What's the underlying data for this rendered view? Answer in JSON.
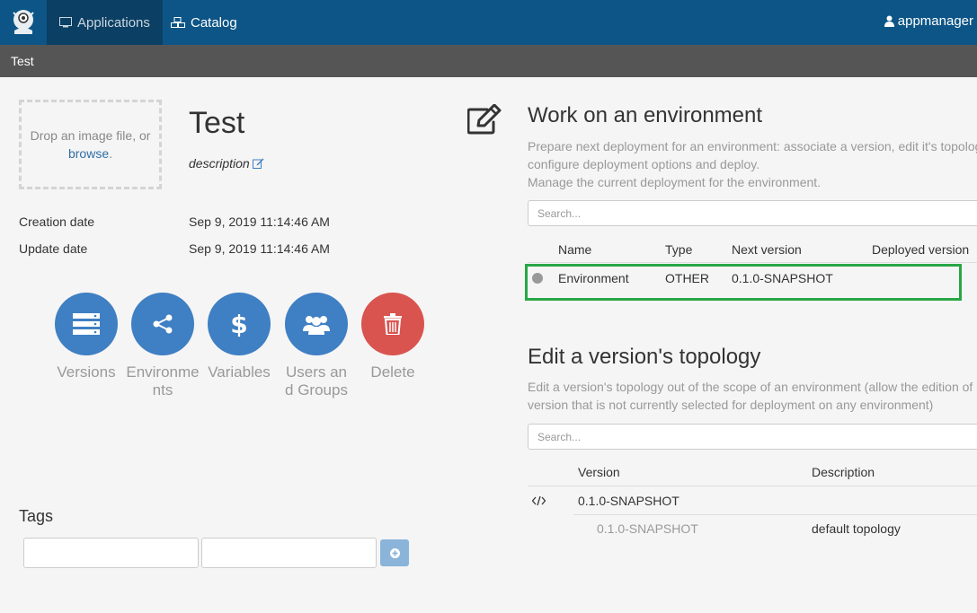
{
  "nav": {
    "tabs": [
      {
        "label": "Applications",
        "icon": "monitor-icon"
      },
      {
        "label": "Catalog",
        "icon": "cubes-icon"
      }
    ],
    "user": "appmanager"
  },
  "breadcrumb": "Test",
  "app": {
    "dropzone_text": "Drop an image file, or",
    "dropzone_link": "browse",
    "dropzone_period": ".",
    "title": "Test",
    "description": "description",
    "creation_label": "Creation date",
    "creation_value": "Sep 9, 2019 11:14:46 AM",
    "update_label": "Update date",
    "update_value": "Sep 9, 2019 11:14:46 AM"
  },
  "actions": [
    {
      "label": "Versions",
      "icon": "server-icon",
      "color": "#3f7fc3"
    },
    {
      "label": "Environments",
      "icon": "share-icon",
      "color": "#3f7fc3"
    },
    {
      "label": "Variables",
      "icon": "dollar-icon",
      "color": "#3f7fc3"
    },
    {
      "label": "Users and Groups",
      "icon": "users-icon",
      "color": "#3f7fc3"
    },
    {
      "label": "Delete",
      "icon": "trash-icon",
      "color": "#d9534f"
    }
  ],
  "tags": {
    "title": "Tags"
  },
  "environments": {
    "title": "Work on an environment",
    "desc1": "Prepare next deployment for an environment: associate a version, edit it's topology,",
    "desc2": "configure deployment options and deploy.",
    "desc3": "Manage the current deployment for the environment.",
    "search_placeholder": "Search...",
    "columns": [
      "Name",
      "Type",
      "Next version",
      "Deployed version"
    ],
    "rows": [
      {
        "name": "Environment",
        "type": "OTHER",
        "next_version": "0.1.0-SNAPSHOT",
        "deployed_version": ""
      }
    ]
  },
  "topology": {
    "title": "Edit a version's topology",
    "desc1": "Edit a version's topology out of the scope of an environment (allow the edition of a",
    "desc2": "version that is not currently selected for deployment on any environment)",
    "search_placeholder": "Search...",
    "columns": [
      "Version",
      "Description"
    ],
    "version_row": "0.1.0-SNAPSHOT",
    "sub_row": {
      "version": "0.1.0-SNAPSHOT",
      "description": "default topology"
    }
  }
}
